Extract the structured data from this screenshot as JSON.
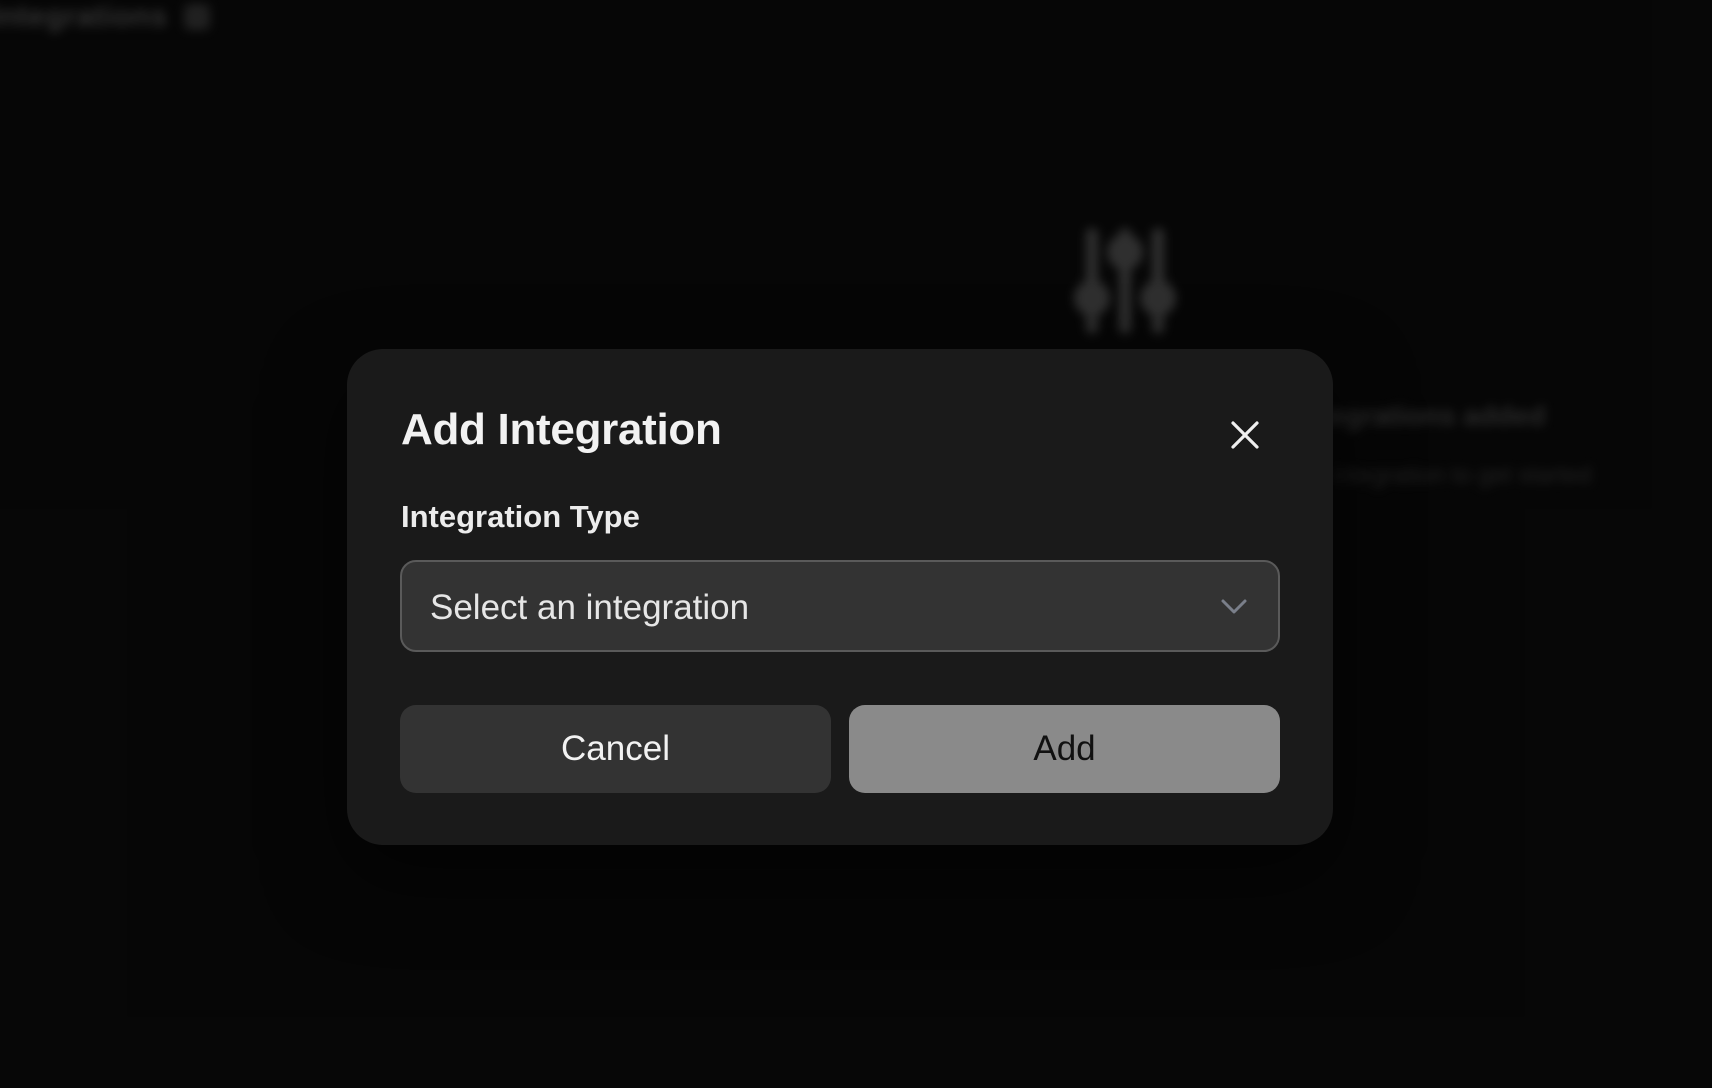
{
  "background": {
    "page_title": "Integrations",
    "empty_state_title": "No integrations added",
    "empty_state_subtitle": "Add an integration to get started"
  },
  "dialog": {
    "title": "Add Integration",
    "close_icon": "close-icon",
    "field_label": "Integration Type",
    "select": {
      "value": "Select an integration",
      "icon": "chevron-down-icon"
    },
    "cancel_label": "Cancel",
    "add_label": "Add"
  },
  "colors": {
    "page_bg": "#0a0a0a",
    "dialog_bg": "#1a1a1a",
    "select_bg": "#333333",
    "select_border": "#5a5a5a",
    "cancel_bg": "#333333",
    "add_bg": "#8a8a8a"
  }
}
